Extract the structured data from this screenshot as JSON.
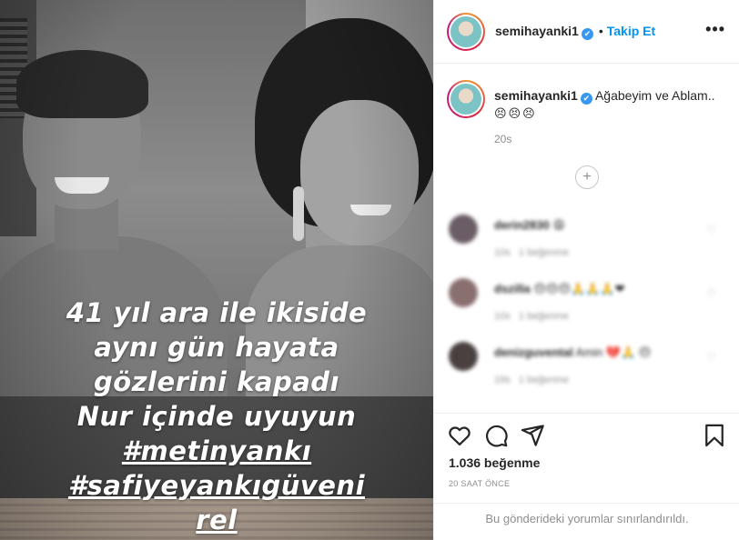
{
  "post": {
    "overlay_lines": [
      "41 yıl ara ile ikiside",
      "aynı gün hayata",
      "gözlerini kapadı",
      "Nur içinde uyuyun"
    ],
    "hashtag_lines": [
      "#metinyankı",
      "#safiyeyankıgüveni",
      "rel"
    ]
  },
  "header": {
    "username": "semihayanki1",
    "verified_icon": "✔",
    "separator": "•",
    "follow_label": "Takip Et",
    "more_label": "•••"
  },
  "caption": {
    "username": "semihayanki1",
    "text": "Ağabeyim ve Ablam..",
    "emojis": "😣😣😣",
    "time": "20s"
  },
  "load_more_label": "+",
  "comments": [
    {
      "user": "derin2830",
      "text": "😩",
      "time": "10s",
      "likes": "1 beğenme"
    },
    {
      "user": "dszilla",
      "text": "😔😔😔🙏🙏🙏❤",
      "time": "10s",
      "likes": "1 beğenme"
    },
    {
      "user": "denizguvental",
      "text": "Amin 💔🙏 😔",
      "time": "19s",
      "likes": "1 beğenme"
    }
  ],
  "stats": {
    "likes": "1.036 beğenme",
    "time_ago": "20 SAAT ÖNCE",
    "restricted": "Bu gönderideki yorumlar sınırlandırıldı."
  },
  "icons": {
    "like": "heart-icon",
    "comment": "comment-icon",
    "share": "share-icon",
    "save": "bookmark-icon"
  }
}
